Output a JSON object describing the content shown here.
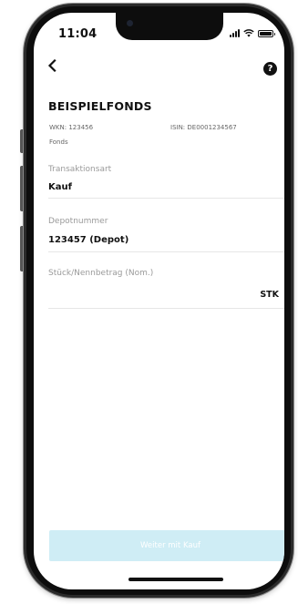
{
  "status_bar": {
    "time": "11:04"
  },
  "header": {
    "back_icon": "chevron-left-icon",
    "help_icon": "question-mark-icon",
    "help_glyph": "?"
  },
  "fund": {
    "name": "BEISPIELFONDS",
    "wkn": "WKN: 123456",
    "isin": "ISIN: DE0001234567",
    "type": "Fonds"
  },
  "form": {
    "transaction_type": {
      "label": "Transaktionsart",
      "value": "Kauf"
    },
    "depot": {
      "label": "Depotnummer",
      "value": "123457 (Depot)"
    },
    "quantity": {
      "label": "Stück/Nennbetrag (Nom.)",
      "value": "",
      "unit": "STK"
    }
  },
  "footer": {
    "continue_label": "Weiter mit Kauf"
  },
  "colors": {
    "button_disabled": "#cfedf5",
    "text": "#111111",
    "label": "#9a9a9a"
  }
}
